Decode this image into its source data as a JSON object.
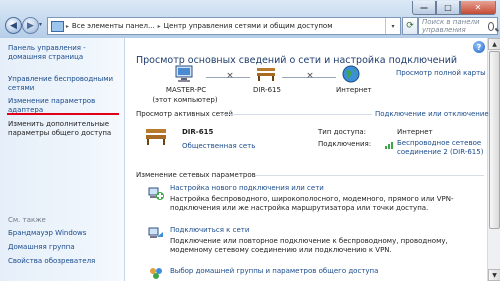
{
  "window": {
    "minimize": "—",
    "maximize": "□",
    "close": "✕"
  },
  "address": {
    "seg1": "Все элементы панел...",
    "seg2": "Центр управления сетями и общим доступом",
    "search_placeholder": "Поиск в панели управления"
  },
  "sidebar": {
    "home": "Панель управления - домашняя страница",
    "wireless": "Управление беспроводными сетями",
    "adapter": "Изменение параметров адаптера",
    "sharing": "Изменить дополнительные параметры общего доступа",
    "see_also": "См. также",
    "see": [
      "Брандмауэр Windows",
      "Домашняя группа",
      "Свойства обозревателя"
    ]
  },
  "main": {
    "heading": "Просмотр основных сведений о сети и настройка подключений",
    "full_map": "Просмотр полной карты",
    "nodes": {
      "pc_name": "MASTER-PC",
      "pc_sub": "(этот компьютер)",
      "router": "DIR-615",
      "internet": "Интернет"
    },
    "active": {
      "title": "Просмотр активных сетей",
      "connect_link": "Подключение или отключение",
      "net_name": "DIR-615",
      "net_type": "Общественная сеть",
      "access_label": "Тип доступа:",
      "access_value": "Интернет",
      "conn_label": "Подключения:",
      "conn_value": "Беспроводное сетевое соединение 2 (DIR-615)"
    },
    "change": {
      "title": "Изменение сетевых параметров",
      "tasks": [
        {
          "title": "Настройка нового подключения или сети",
          "desc": "Настройка беспроводного, широкополосного, модемного, прямого или VPN-подключения или же настройка маршрутизатора или точки доступа."
        },
        {
          "title": "Подключиться к сети",
          "desc": "Подключение или повторное подключение к беспроводному, проводному, модемному сетевому соединению или подключению к VPN."
        },
        {
          "title": "Выбор домашней группы и параметров общего доступа",
          "desc": ""
        }
      ]
    }
  }
}
